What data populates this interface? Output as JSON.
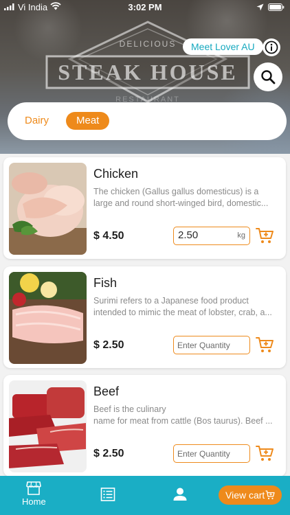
{
  "status_bar": {
    "carrier": "Vi India",
    "time": "3:02 PM"
  },
  "hero": {
    "sign_top": "DELICIOUS",
    "sign_main": "STEAK HOUSE",
    "sign_bottom": "RESTAURANT"
  },
  "header": {
    "store_name": "Meet Lover AU"
  },
  "categories": [
    {
      "label": "Dairy",
      "active": false
    },
    {
      "label": "Meat",
      "active": true
    }
  ],
  "products": [
    {
      "name": "Chicken",
      "desc_line1": "The chicken (Gallus gallus domesticus) is a",
      "desc_line2": "large and round short-winged bird, domestic...",
      "price": "$ 4.50",
      "quantity": "2.50",
      "unit": "kg",
      "placeholder": ""
    },
    {
      "name": "Fish",
      "desc_line1": "Surimi refers to a Japanese food product",
      "desc_line2": "intended to mimic the meat of lobster, crab, a...",
      "price": "$ 2.50",
      "quantity": "",
      "unit": "",
      "placeholder": "Enter Quantity"
    },
    {
      "name": "Beef",
      "desc_line1": "Beef is the culinary",
      "desc_line2": "name for meat from cattle (Bos taurus). Beef ...",
      "price": "$ 2.50",
      "quantity": "",
      "unit": "",
      "placeholder": "Enter Quantity"
    }
  ],
  "bottom_nav": {
    "home_label": "Home",
    "view_cart_label": "View cart"
  },
  "colors": {
    "accent_orange": "#ee8a1b",
    "accent_teal": "#1aaec5"
  },
  "icons": [
    "wifi-icon",
    "location-arrow-icon",
    "battery-icon",
    "info-icon",
    "search-icon",
    "add-to-cart-icon",
    "store-icon",
    "list-icon",
    "user-icon",
    "cart-icon"
  ]
}
